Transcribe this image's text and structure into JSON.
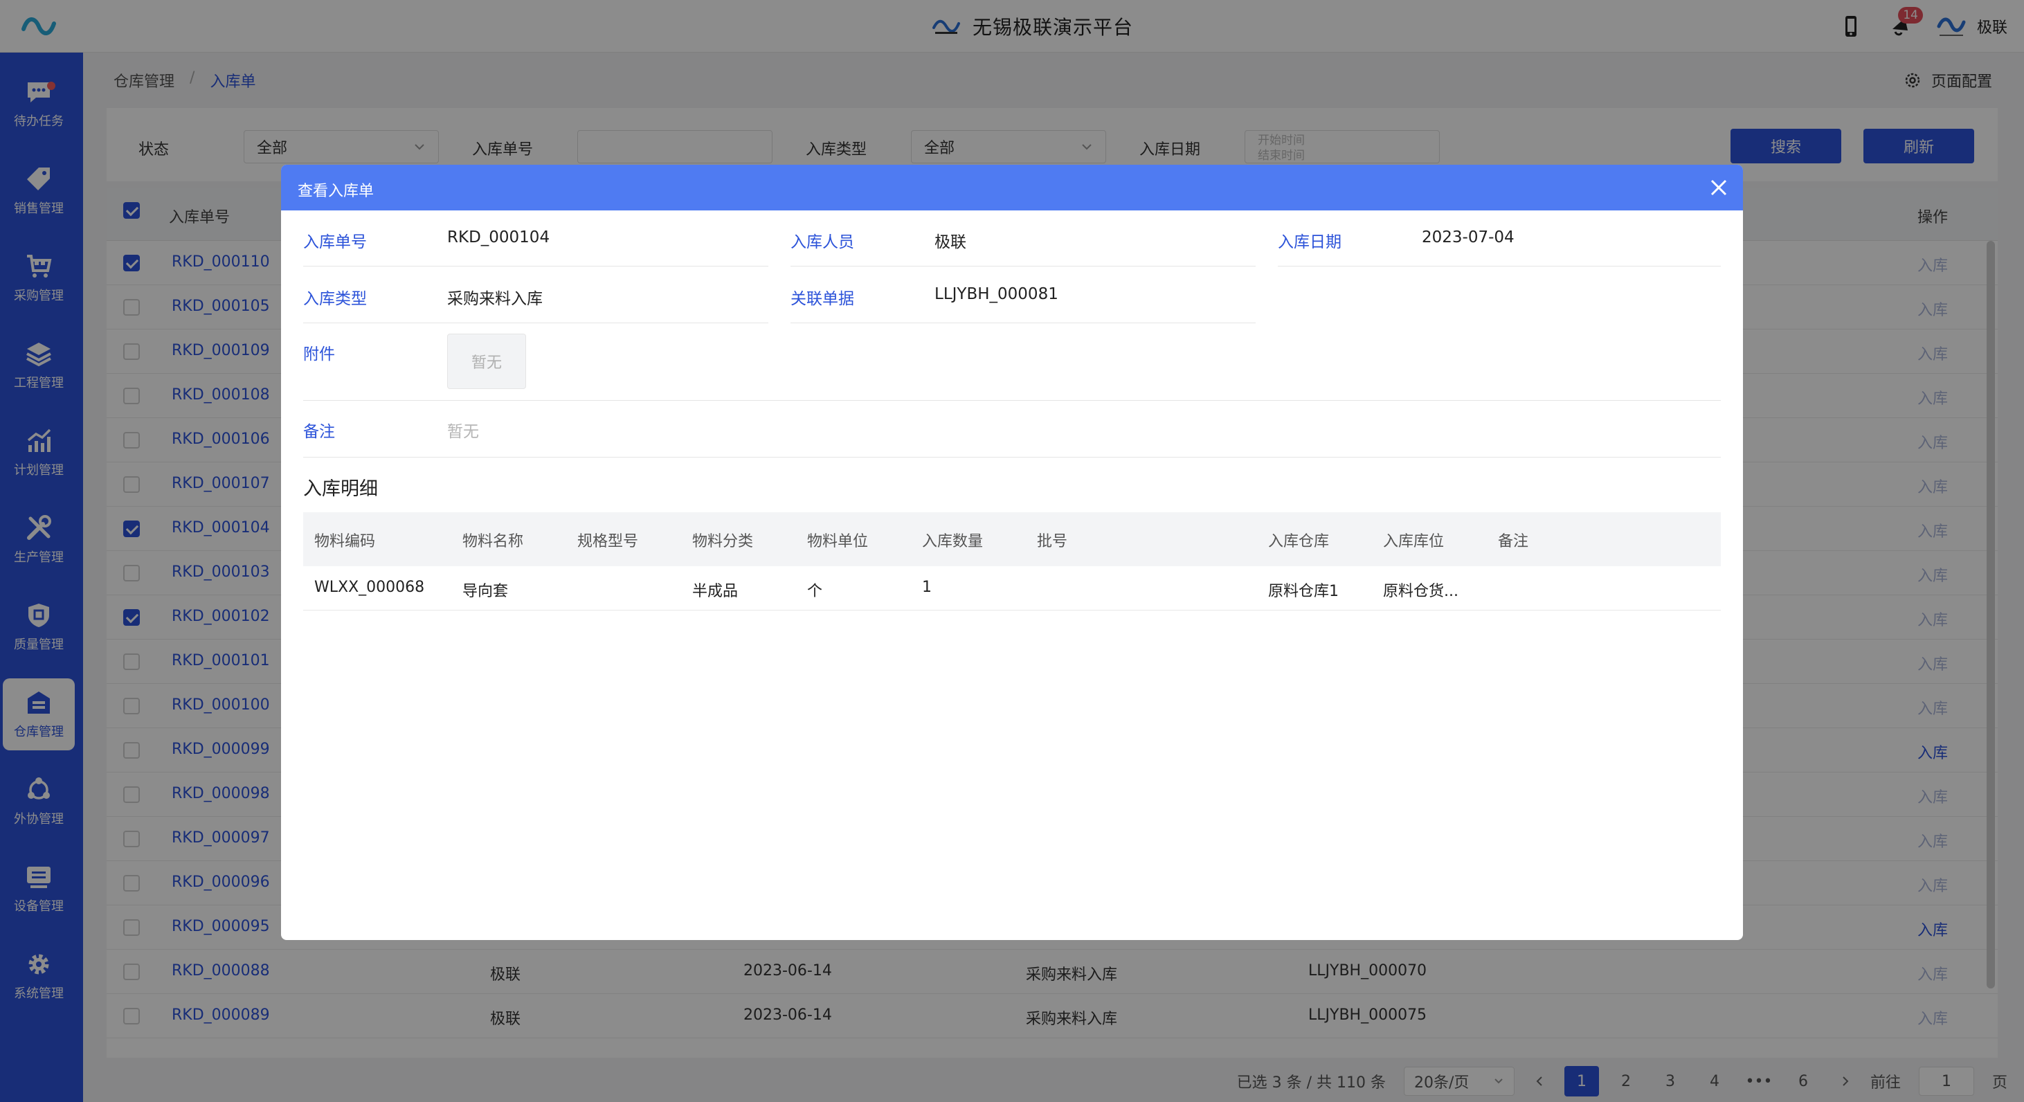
{
  "app": {
    "title": "无锡极联演示平台",
    "notification_count": "14",
    "user_name": "极联"
  },
  "sidebar": {
    "items": [
      {
        "label": "待办任务",
        "icon": "chat-icon"
      },
      {
        "label": "销售管理",
        "icon": "tag-icon"
      },
      {
        "label": "采购管理",
        "icon": "cart-icon"
      },
      {
        "label": "工程管理",
        "icon": "layers-icon"
      },
      {
        "label": "计划管理",
        "icon": "chart-icon"
      },
      {
        "label": "生产管理",
        "icon": "tools-icon"
      },
      {
        "label": "质量管理",
        "icon": "shield-icon"
      },
      {
        "label": "仓库管理",
        "icon": "warehouse-icon"
      },
      {
        "label": "外协管理",
        "icon": "network-icon"
      },
      {
        "label": "设备管理",
        "icon": "monitor-icon"
      },
      {
        "label": "系统管理",
        "icon": "gear-icon"
      }
    ]
  },
  "breadcrumb": {
    "parent": "仓库管理",
    "sep": "/",
    "current": "入库单"
  },
  "page_config_label": "页面配置",
  "filters": {
    "status_label": "状态",
    "status_value": "全部",
    "order_no_label": "入库单号",
    "order_no_value": "",
    "type_label": "入库类型",
    "type_value": "全部",
    "date_label": "入库日期",
    "date_start_placeholder": "开始时间",
    "date_end_placeholder": "结束时间",
    "search_button": "搜索",
    "refresh_button": "刷新"
  },
  "table": {
    "headers": {
      "order_no": "入库单号",
      "actions": "操作"
    },
    "rows": [
      {
        "no": "RKD_000110",
        "checked": true,
        "person": "",
        "date": "",
        "type": "",
        "ref": "",
        "action": "入库",
        "enabled": false
      },
      {
        "no": "RKD_000105",
        "checked": false,
        "person": "",
        "date": "",
        "type": "",
        "ref": "",
        "action": "入库",
        "enabled": false
      },
      {
        "no": "RKD_000109",
        "checked": false,
        "person": "",
        "date": "",
        "type": "",
        "ref": "",
        "action": "入库",
        "enabled": false
      },
      {
        "no": "RKD_000108",
        "checked": false,
        "person": "",
        "date": "",
        "type": "",
        "ref": "",
        "action": "入库",
        "enabled": false
      },
      {
        "no": "RKD_000106",
        "checked": false,
        "person": "",
        "date": "",
        "type": "",
        "ref": "",
        "action": "入库",
        "enabled": false
      },
      {
        "no": "RKD_000107",
        "checked": false,
        "person": "",
        "date": "",
        "type": "",
        "ref": "",
        "action": "入库",
        "enabled": false
      },
      {
        "no": "RKD_000104",
        "checked": true,
        "person": "",
        "date": "",
        "type": "",
        "ref": "",
        "action": "入库",
        "enabled": false
      },
      {
        "no": "RKD_000103",
        "checked": false,
        "person": "",
        "date": "",
        "type": "",
        "ref": "",
        "action": "入库",
        "enabled": false
      },
      {
        "no": "RKD_000102",
        "checked": true,
        "person": "",
        "date": "",
        "type": "",
        "ref": "",
        "action": "入库",
        "enabled": false
      },
      {
        "no": "RKD_000101",
        "checked": false,
        "person": "",
        "date": "",
        "type": "",
        "ref": "",
        "action": "入库",
        "enabled": false
      },
      {
        "no": "RKD_000100",
        "checked": false,
        "person": "",
        "date": "",
        "type": "",
        "ref": "",
        "action": "入库",
        "enabled": false
      },
      {
        "no": "RKD_000099",
        "checked": false,
        "person": "",
        "date": "",
        "type": "",
        "ref": "",
        "action": "入库",
        "enabled": true
      },
      {
        "no": "RKD_000098",
        "checked": false,
        "person": "",
        "date": "",
        "type": "",
        "ref": "",
        "action": "入库",
        "enabled": false
      },
      {
        "no": "RKD_000097",
        "checked": false,
        "person": "",
        "date": "",
        "type": "",
        "ref": "",
        "action": "入库",
        "enabled": false
      },
      {
        "no": "RKD_000096",
        "checked": false,
        "person": "",
        "date": "",
        "type": "",
        "ref": "",
        "action": "入库",
        "enabled": false
      },
      {
        "no": "RKD_000095",
        "checked": false,
        "person": "",
        "date": "",
        "type": "",
        "ref": "",
        "action": "入库",
        "enabled": true
      },
      {
        "no": "RKD_000088",
        "checked": false,
        "person": "极联",
        "date": "2023-06-14",
        "type": "采购来料入库",
        "ref": "LLJYBH_000070",
        "action": "入库",
        "enabled": false
      },
      {
        "no": "RKD_000089",
        "checked": false,
        "person": "极联",
        "date": "2023-06-14",
        "type": "采购来料入库",
        "ref": "LLJYBH_000075",
        "action": "入库",
        "enabled": false
      }
    ]
  },
  "pagination": {
    "summary": "已选 3 条 / 共 110 条",
    "page_size": "20条/页",
    "pages": [
      "1",
      "2",
      "3",
      "4",
      "•••",
      "6"
    ],
    "current_page": "1",
    "goto_label": "前往",
    "goto_value": "1",
    "goto_suffix": "页"
  },
  "modal": {
    "title": "查看入库单",
    "fields": {
      "order_no_label": "入库单号",
      "order_no": "RKD_000104",
      "person_label": "入库人员",
      "person": "极联",
      "date_label": "入库日期",
      "date": "2023-07-04",
      "type_label": "入库类型",
      "type": "采购来料入库",
      "ref_label": "关联单据",
      "ref": "LLJYBH_000081",
      "attachment_label": "附件",
      "attachment_empty": "暂无",
      "remark_label": "备注",
      "remark_empty": "暂无"
    },
    "detail_title": "入库明细",
    "detail_headers": [
      "物料编码",
      "物料名称",
      "规格型号",
      "物料分类",
      "物料单位",
      "入库数量",
      "批号",
      "入库仓库",
      "入库库位",
      "备注"
    ],
    "detail_rows": [
      [
        "WLXX_000068",
        "导向套",
        "",
        "半成品",
        "个",
        "1",
        "",
        "原料仓库1",
        "原料仓货...",
        ""
      ]
    ]
  }
}
